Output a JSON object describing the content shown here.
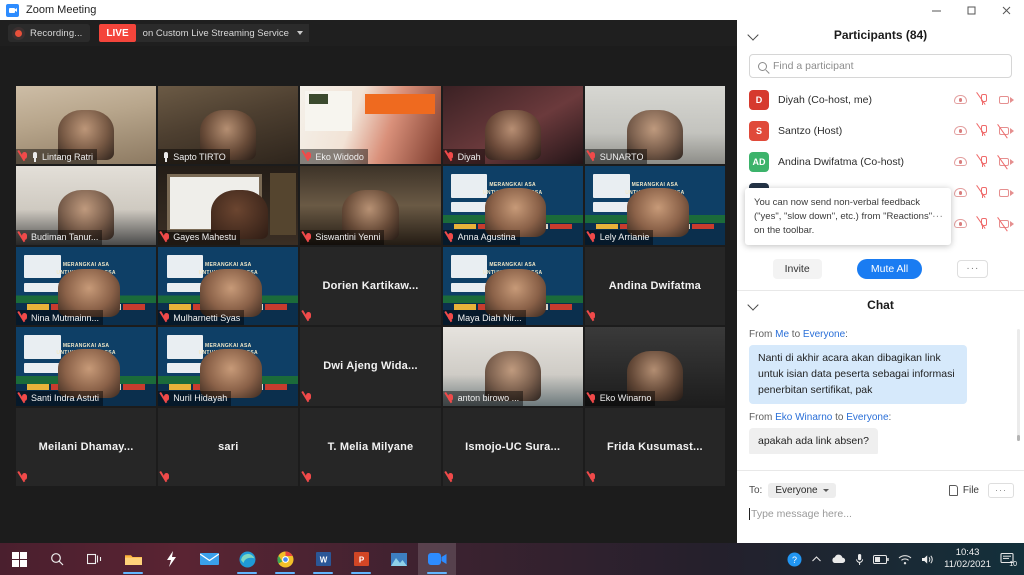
{
  "window": {
    "title": "Zoom Meeting",
    "app_icon": "zoom-video-icon",
    "minimize": "minimize-icon",
    "maximize": "maximize-icon",
    "close": "close-icon"
  },
  "toolbar": {
    "recording_label": "Recording...",
    "live_badge": "LIVE",
    "live_service": "on Custom Live Streaming Service",
    "dropdown_icon": "chevron-down-icon"
  },
  "grid": {
    "tiles": [
      {
        "name": "Lintang Ratri",
        "muted": true,
        "pinned": true,
        "kind": "photo",
        "style": "shelf-light",
        "active": false
      },
      {
        "name": "Sapto TIRTO",
        "muted": false,
        "pinned": true,
        "kind": "photo",
        "style": "shelf-dark",
        "active": true
      },
      {
        "name": "Eko Widodo",
        "muted": true,
        "pinned": false,
        "kind": "photo",
        "style": "slide-orange",
        "active": false
      },
      {
        "name": "Diyah",
        "muted": true,
        "pinned": false,
        "kind": "photo",
        "style": "dark-red",
        "active": false
      },
      {
        "name": "SUNARTO",
        "muted": true,
        "pinned": false,
        "kind": "photo",
        "style": "plain-grey",
        "active": false
      },
      {
        "name": "Budiman Tanur...",
        "muted": true,
        "pinned": false,
        "kind": "photo",
        "style": "wall-white",
        "active": false
      },
      {
        "name": "Gayes Mahestu",
        "muted": true,
        "pinned": false,
        "kind": "photo",
        "style": "frame-dark",
        "active": false
      },
      {
        "name": "Siswantini Yenni",
        "muted": true,
        "pinned": false,
        "kind": "photo",
        "style": "books",
        "active": false
      },
      {
        "name": "Anna Agustina",
        "muted": true,
        "pinned": false,
        "kind": "photo",
        "style": "webinar-slide",
        "active": false
      },
      {
        "name": "Lely Arrianie",
        "muted": true,
        "pinned": false,
        "kind": "photo",
        "style": "webinar-slide",
        "active": false
      },
      {
        "name": "Nina Mutmainn...",
        "muted": true,
        "pinned": false,
        "kind": "photo",
        "style": "webinar-slide",
        "active": false
      },
      {
        "name": "Mulharnetti Syas",
        "muted": true,
        "pinned": false,
        "kind": "photo",
        "style": "webinar-slide",
        "active": false
      },
      {
        "name": "Dorien  Kartikaw...",
        "muted": true,
        "pinned": false,
        "kind": "name",
        "style": "",
        "active": false
      },
      {
        "name": "Maya Diah Nir...",
        "muted": true,
        "pinned": false,
        "kind": "photo",
        "style": "webinar-slide",
        "active": false
      },
      {
        "name": "Andina Dwifatma",
        "muted": true,
        "pinned": false,
        "kind": "name",
        "style": "",
        "active": false
      },
      {
        "name": "Santi  Indra Astuti",
        "muted": true,
        "pinned": false,
        "kind": "photo",
        "style": "webinar-slide",
        "active": false
      },
      {
        "name": "Nuril Hidayah",
        "muted": true,
        "pinned": false,
        "kind": "photo",
        "style": "webinar-slide",
        "active": false
      },
      {
        "name": "Dwi Ajeng Wida...",
        "muted": true,
        "pinned": false,
        "kind": "name",
        "style": "",
        "active": false
      },
      {
        "name": "anton birowo ...",
        "muted": true,
        "pinned": false,
        "kind": "photo",
        "style": "room-light",
        "active": false
      },
      {
        "name": "Eko Winarno",
        "muted": true,
        "pinned": false,
        "kind": "photo",
        "style": "room-dark",
        "active": false
      },
      {
        "name": "Meilani  Dhamay...",
        "muted": true,
        "pinned": false,
        "kind": "name",
        "style": "",
        "active": false
      },
      {
        "name": "sari",
        "muted": true,
        "pinned": false,
        "kind": "name",
        "style": "",
        "active": false
      },
      {
        "name": "T. Melia Milyane",
        "muted": true,
        "pinned": false,
        "kind": "name",
        "style": "",
        "active": false
      },
      {
        "name": "Ismojo-UC  Sura...",
        "muted": true,
        "pinned": false,
        "kind": "name",
        "style": "",
        "active": false
      },
      {
        "name": "Frida Kusumast...",
        "muted": true,
        "pinned": false,
        "kind": "name",
        "style": "",
        "active": false
      }
    ]
  },
  "participants": {
    "header": "Participants (84)",
    "collapse_icon": "chevron-down-icon",
    "search_placeholder": "Find a participant",
    "search_value": "",
    "search_icon": "search-icon",
    "rows": [
      {
        "initials": "D",
        "color": "#d63a2e",
        "name": "Diyah (Co-host, me)",
        "camera_off": false
      },
      {
        "initials": "S",
        "color": "#e04a3a",
        "name": "Santzo (Host)",
        "camera_off": true
      },
      {
        "initials": "AD",
        "color": "#3cb36b",
        "name": "Andina Dwifatma (Co-host)",
        "camera_off": true
      },
      {
        "initials": "",
        "color": "#243447",
        "name": "",
        "camera_off": false
      },
      {
        "initials": "",
        "color": "#243447",
        "name": "",
        "camera_off": true
      }
    ],
    "tooltip": "You can now send non-verbal feedback (\"yes\", \"slow down\", etc.) from \"Reactions\" on the toolbar.",
    "tooltip_close": "close-icon",
    "invite_label": "Invite",
    "mute_all_label": "Mute All",
    "more_label": "···"
  },
  "chat": {
    "header": "Chat",
    "collapse_icon": "chevron-down-icon",
    "messages": [
      {
        "prefix": "From ",
        "sender": "Eko Winarno",
        "mid": " to ",
        "target": "Everyone",
        "suffix": ":",
        "text": "apakah ada link absen?",
        "own": false
      },
      {
        "prefix": "From ",
        "sender": "Me",
        "mid": " to ",
        "target": "Everyone",
        "suffix": ":",
        "text": "Nanti di akhir acara akan dibagikan link untuk isian data peserta sebagai informasi penerbitan sertifikat, pak",
        "own": true
      }
    ],
    "to_label": "To:",
    "to_value": "Everyone",
    "to_caret": "chevron-down-icon",
    "file_label": "File",
    "file_icon": "file-icon",
    "more_label": "···",
    "input_placeholder": "Type message here..."
  },
  "taskbar": {
    "items": [
      {
        "name": "start-button",
        "icon": "windows-logo-icon"
      },
      {
        "name": "search-button",
        "icon": "search-icon"
      },
      {
        "name": "task-view-button",
        "icon": "task-view-icon"
      },
      {
        "name": "file-explorer-button",
        "icon": "folder-icon"
      },
      {
        "name": "flash-app-button",
        "icon": "lightning-icon"
      },
      {
        "name": "mail-button",
        "icon": "mail-icon"
      },
      {
        "name": "edge-button",
        "icon": "edge-icon"
      },
      {
        "name": "chrome-button",
        "icon": "chrome-icon"
      },
      {
        "name": "word-button",
        "icon": "word-icon"
      },
      {
        "name": "powerpoint-button",
        "icon": "powerpoint-icon"
      },
      {
        "name": "photos-button",
        "icon": "photos-icon"
      },
      {
        "name": "zoom-button",
        "icon": "zoom-video-icon"
      }
    ],
    "tray": {
      "help_icon": "help-circle-icon",
      "chevron_icon": "chevron-up-icon",
      "cloud_icon": "cloud-icon",
      "mic_icon": "microphone-icon",
      "battery_icon": "battery-icon",
      "wifi_icon": "wifi-icon",
      "volume_icon": "speaker-icon",
      "time": "10:43",
      "date": "11/02/2021",
      "notifications_icon": "notification-icon",
      "notifications_count": "10"
    }
  }
}
